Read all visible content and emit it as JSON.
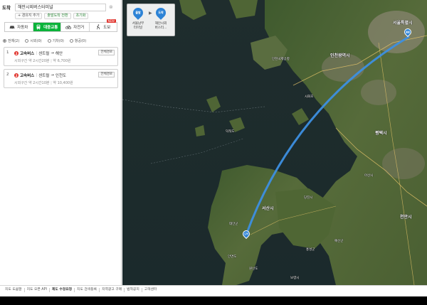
{
  "search": {
    "dest_label": "도착",
    "dest_value": "해안시외버스터미널",
    "clear_icon": "x-icon"
  },
  "options": [
    {
      "label": "+ 경유지 추가",
      "tone": "gray"
    },
    {
      "label": "출발도착 전환",
      "tone": "green"
    },
    {
      "label": "초기화",
      "tone": "green"
    }
  ],
  "modes": [
    {
      "label": "자동차",
      "icon": "car-icon"
    },
    {
      "label": "대중교통",
      "icon": "bus-icon"
    },
    {
      "label": "자전거",
      "icon": "bicycle-icon"
    },
    {
      "label": "도보",
      "icon": "walk-icon",
      "badge": "NEW"
    }
  ],
  "filters": [
    {
      "label": "전체(2)",
      "checked": true
    },
    {
      "label": "시외(0)",
      "checked": false
    },
    {
      "label": "기차(0)",
      "checked": false
    },
    {
      "label": "항공(0)",
      "checked": false
    }
  ],
  "routes": [
    {
      "num": "1",
      "bus_icon": "2",
      "bus": "고속버스",
      "from": "센트럴",
      "to": "해안",
      "summary": "시외구간 약 2시간20분",
      "fare": "약 6,700원",
      "detail": "전체경로"
    },
    {
      "num": "2",
      "bus_icon": "2",
      "bus": "고속버스",
      "from": "센트럴",
      "to": "인천도",
      "summary": "시외구간 약 2시간10분",
      "fare": "약 10,400원",
      "detail": "전체경로"
    }
  ],
  "map": {
    "summary_start_pin": "출발",
    "summary_end_pin": "도착",
    "summary_start": "서울남부\n터미널",
    "summary_end": "해안시외\n버스터...",
    "start_pin": "출발",
    "end_pin": "도착",
    "labels": [
      {
        "text": "서울특별시"
      },
      {
        "text": "인천광역시"
      },
      {
        "text": "인천국제공항"
      },
      {
        "text": "시화호"
      },
      {
        "text": "평택시"
      },
      {
        "text": "덕적도"
      },
      {
        "text": "아산시"
      },
      {
        "text": "당진시"
      },
      {
        "text": "서산시"
      },
      {
        "text": "천안시"
      },
      {
        "text": "태안군"
      },
      {
        "text": "보령시"
      },
      {
        "text": "홍성군"
      },
      {
        "text": "예산군"
      },
      {
        "text": "원산도"
      },
      {
        "text": "안면도"
      }
    ],
    "colors": {
      "route": "#3d8fe0",
      "pin": "#2d83d6"
    }
  },
  "footer": {
    "links": [
      {
        "label": "지도 도움말",
        "strong": false
      },
      {
        "label": "지도 오픈 API",
        "strong": false
      },
      {
        "label": "제도 수정요청",
        "strong": true
      },
      {
        "label": "지도 검색등록",
        "strong": false
      },
      {
        "label": "지역광고 구매",
        "strong": false
      },
      {
        "label": "법적공지",
        "strong": false
      },
      {
        "label": "고객센터",
        "strong": false
      }
    ]
  }
}
